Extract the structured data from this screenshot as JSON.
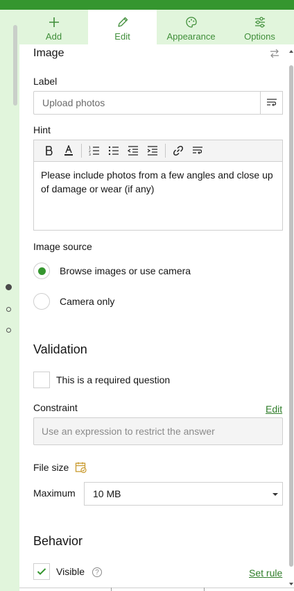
{
  "tabs": [
    {
      "label": "Add",
      "icon": "plus-icon"
    },
    {
      "label": "Edit",
      "icon": "pencil-icon"
    },
    {
      "label": "Appearance",
      "icon": "palette-icon"
    },
    {
      "label": "Options",
      "icon": "sliders-icon"
    }
  ],
  "active_tab": "Edit",
  "question": {
    "type": "Image",
    "label_heading": "Label",
    "label_placeholder": "Upload photos",
    "hint_heading": "Hint",
    "hint_text": "Please include photos from a few angles and close up of damage or wear (if any)",
    "image_source_heading": "Image source",
    "image_source_options": [
      "Browse images or use camera",
      "Camera only"
    ],
    "image_source_selected": 0
  },
  "validation": {
    "heading": "Validation",
    "required_label": "This is a required question",
    "required_checked": false,
    "constraint_heading": "Constraint",
    "constraint_edit": "Edit",
    "constraint_placeholder": "Use an expression to restrict the answer",
    "file_size_heading": "File size",
    "maximum_label": "Maximum",
    "maximum_value": "10 MB"
  },
  "behavior": {
    "heading": "Behavior",
    "visible_label": "Visible",
    "visible_checked": true,
    "set_rule": "Set rule"
  },
  "colors": {
    "accent": "#35962f",
    "tab_bg": "#e1f5dc",
    "link": "#2f7d2a"
  }
}
